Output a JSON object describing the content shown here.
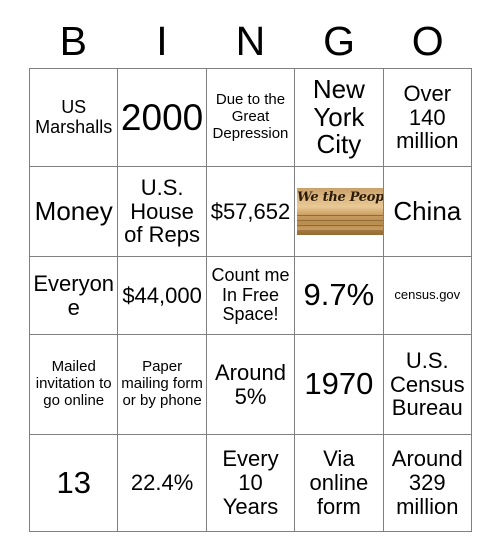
{
  "card": {
    "header_letters": [
      "B",
      "I",
      "N",
      "G",
      "O"
    ],
    "rows": [
      [
        {
          "text": "US Marshalls",
          "size": "sz-sm",
          "type": "text"
        },
        {
          "text": "2000",
          "size": "sz-xxl",
          "type": "text"
        },
        {
          "text": "Due to the Great Depression",
          "size": "sz-xs",
          "type": "text"
        },
        {
          "text": "New York City",
          "size": "sz-lg",
          "type": "text"
        },
        {
          "text": "Over 140 million",
          "size": "sz-md",
          "type": "text"
        }
      ],
      [
        {
          "text": "Money",
          "size": "sz-lg",
          "type": "text"
        },
        {
          "text": "U.S. House of Reps",
          "size": "sz-md",
          "type": "text"
        },
        {
          "text": "$57,652",
          "size": "sz-md",
          "type": "text"
        },
        {
          "text": "We the People",
          "size": "sz-xs",
          "type": "image",
          "image_name": "us-constitution-we-the-people"
        },
        {
          "text": "China",
          "size": "sz-lg",
          "type": "text"
        }
      ],
      [
        {
          "text": "Everyone",
          "size": "sz-md",
          "type": "text"
        },
        {
          "text": "$44,000",
          "size": "sz-md",
          "type": "text"
        },
        {
          "text": "Count me In Free Space!",
          "size": "sz-sm",
          "type": "text"
        },
        {
          "text": "9.7%",
          "size": "sz-xl",
          "type": "text"
        },
        {
          "text": "census.gov",
          "size": "sz-xxs",
          "type": "text"
        }
      ],
      [
        {
          "text": "Mailed invitation to go online",
          "size": "sz-xs",
          "type": "text"
        },
        {
          "text": "Paper mailing form or by phone",
          "size": "sz-xs",
          "type": "text"
        },
        {
          "text": "Around 5%",
          "size": "sz-md",
          "type": "text"
        },
        {
          "text": "1970",
          "size": "sz-xl",
          "type": "text"
        },
        {
          "text": "U.S. Census Bureau",
          "size": "sz-md",
          "type": "text"
        }
      ],
      [
        {
          "text": "13",
          "size": "sz-xl",
          "type": "text"
        },
        {
          "text": "22.4%",
          "size": "sz-md",
          "type": "text"
        },
        {
          "text": "Every 10 Years",
          "size": "sz-md",
          "type": "text"
        },
        {
          "text": "Via online form",
          "size": "sz-md",
          "type": "text"
        },
        {
          "text": "Around 329 million",
          "size": "sz-md",
          "type": "text"
        }
      ]
    ],
    "colors": {
      "grid_line": "#808080",
      "text": "#000000",
      "background": "#ffffff",
      "parchment": "#d9b27c"
    }
  }
}
